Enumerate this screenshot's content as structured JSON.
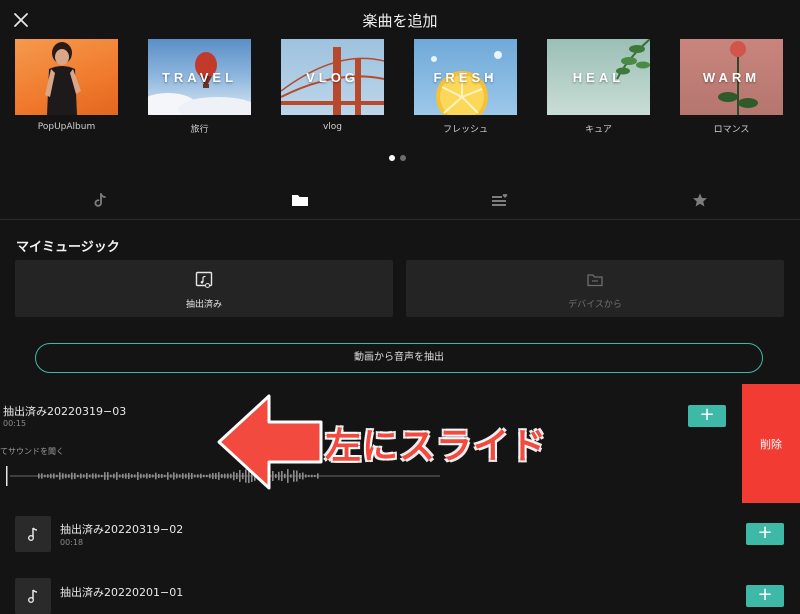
{
  "header": {
    "title": "楽曲を追加"
  },
  "albums": [
    {
      "label": "PopUpAlbum",
      "word": ""
    },
    {
      "label": "旅行",
      "word": "TRAVEL"
    },
    {
      "label": "vlog",
      "word": "VLOG"
    },
    {
      "label": "フレッシュ",
      "word": "FRESH"
    },
    {
      "label": "キュア",
      "word": "HEAL"
    },
    {
      "label": "ロマンス",
      "word": "WARM"
    }
  ],
  "pager": {
    "active_index": 0,
    "count": 2
  },
  "tabs": [
    {
      "icon": "tiktok-icon"
    },
    {
      "icon": "folder-icon",
      "selected": true
    },
    {
      "icon": "playlist-heart-icon"
    },
    {
      "icon": "star-icon"
    }
  ],
  "my_music": {
    "title": "マイミュージック",
    "extracted_label": "抽出済み",
    "device_label": "デバイスから",
    "extract_button": "動画から音声を抽出"
  },
  "tracks": [
    {
      "title": "抽出済み20220319−03",
      "duration": "00:15",
      "preview_hint": "てサウンドを聞く",
      "add": "+",
      "delete": "削除"
    },
    {
      "title": "抽出済み20220319−02",
      "duration": "00:18",
      "add": "+"
    },
    {
      "title": "抽出済み20220201−01",
      "duration": "",
      "add": "+"
    }
  ],
  "annotation": {
    "text": "左にスライド"
  },
  "colors": {
    "background": "#141414",
    "accent": "#3fb9a7",
    "delete": "#f23b32",
    "annotation": "#f24a3f"
  }
}
